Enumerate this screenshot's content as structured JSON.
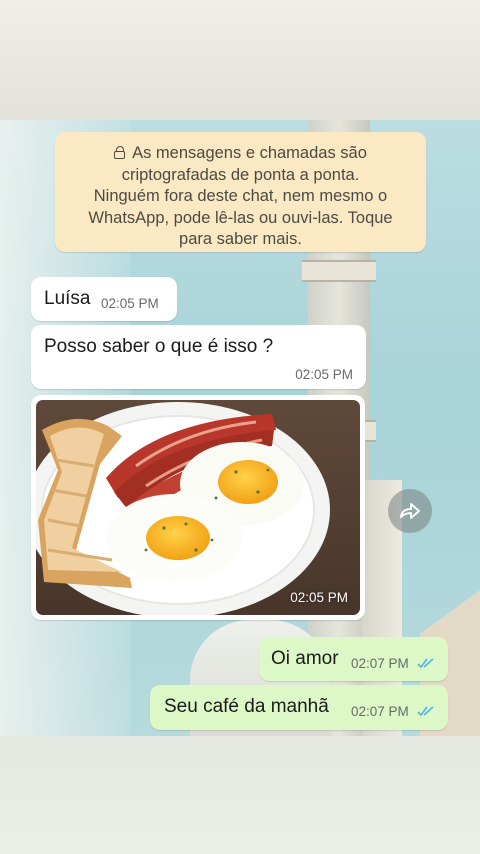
{
  "encryption_notice": {
    "line1": "As mensagens e chamadas são",
    "line2": "criptografadas de ponta a ponta.",
    "line3": "Ninguém fora deste chat, nem mesmo o",
    "line4": "WhatsApp, pode lê-las ou ouvi-las. Toque",
    "line5": "para saber mais."
  },
  "messages": [
    {
      "direction": "incoming",
      "text": "Luísa",
      "time": "02:05 PM"
    },
    {
      "direction": "incoming",
      "text": "Posso saber o que é isso ?",
      "time": "02:05 PM"
    },
    {
      "direction": "incoming",
      "type": "image",
      "image_subject": "breakfast plate with bacon, toast and fried eggs",
      "time": "02:05 PM"
    },
    {
      "direction": "outgoing",
      "text": "Oi amor",
      "time": "02:07 PM",
      "status": "read"
    },
    {
      "direction": "outgoing",
      "text": "Seu café da manhã",
      "time": "02:07 PM",
      "status": "read"
    }
  ],
  "icons": {
    "lock": "lock-icon",
    "forward": "forward-icon",
    "read_receipt": "double-check-icon"
  },
  "colors": {
    "incoming_bubble": "#ffffff",
    "outgoing_bubble": "#dcf8c6",
    "notice_bubble": "#fbe9c4",
    "read_ticks": "#4fb6ec"
  }
}
